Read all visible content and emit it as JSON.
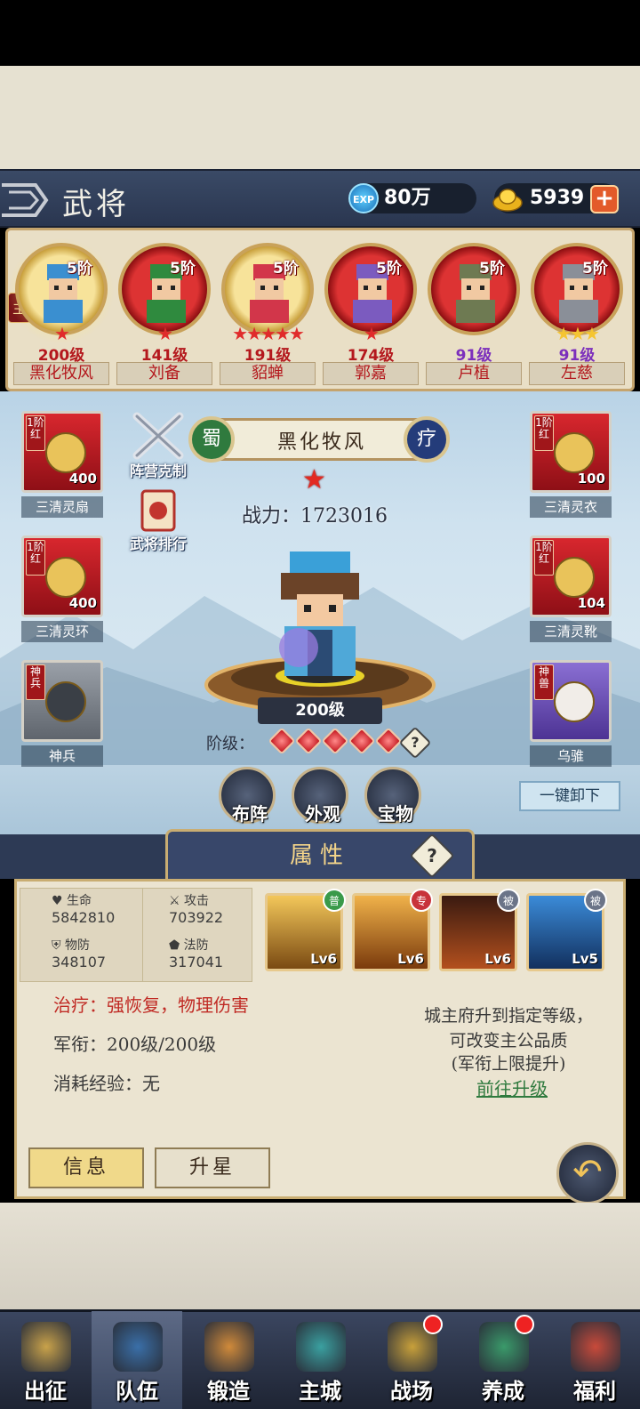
{
  "header": {
    "title": "武将",
    "exp_value": "80万",
    "exp_icon_text": "EXP",
    "gold_value": "5939"
  },
  "roster": {
    "main_tag": "主",
    "heroes": [
      {
        "name": "黑化牧风",
        "level": "200级",
        "rank": "5阶",
        "stars": "★",
        "star_color": "red",
        "frame": "gold-selected"
      },
      {
        "name": "刘备",
        "level": "141级",
        "rank": "5阶",
        "stars": "★",
        "star_color": "red",
        "frame": "red"
      },
      {
        "name": "貂蝉",
        "level": "191级",
        "rank": "5阶",
        "stars": "★★★★★",
        "star_color": "red",
        "frame": "gold"
      },
      {
        "name": "郭嘉",
        "level": "174级",
        "rank": "5阶",
        "stars": "★",
        "star_color": "red",
        "frame": "red"
      },
      {
        "name": "卢植",
        "level": "91级",
        "rank": "5阶",
        "stars": "",
        "star_color": "red",
        "frame": "red"
      },
      {
        "name": "左慈",
        "level": "91级",
        "rank": "5阶",
        "stars": "★★★",
        "star_color": "yellow",
        "frame": "red"
      }
    ]
  },
  "equipment": {
    "left": [
      {
        "name": "三清灵扇",
        "count": "400",
        "tag": "1阶红"
      },
      {
        "name": "三清灵环",
        "count": "400",
        "tag": "1阶红"
      },
      {
        "name": "神兵",
        "count": "",
        "tag": "神兵"
      }
    ],
    "right": [
      {
        "name": "三清灵衣",
        "count": "100",
        "tag": "1阶红"
      },
      {
        "name": "三清灵靴",
        "count": "104",
        "tag": "1阶红"
      },
      {
        "name": "乌骓",
        "count": "",
        "tag": "神兽"
      }
    ]
  },
  "side_buttons": {
    "camp": "阵营克制",
    "ranking": "武将排行"
  },
  "hero_detail": {
    "faction": "蜀",
    "name": "黑化牧风",
    "role": "疗",
    "star": "★",
    "power_label": "战力：",
    "power_value": "1723016",
    "level": "200级",
    "grade_label": "阶级：",
    "grade_gems": 5,
    "grade_help": "?"
  },
  "actions": {
    "formation": "布阵",
    "appearance": "外观",
    "treasure": "宝物",
    "unload_all": "一键卸下"
  },
  "attributes": {
    "tab_title": "属性",
    "help": "?",
    "stats": [
      {
        "label": "生命",
        "value": "5842810",
        "icon": "heart-icon"
      },
      {
        "label": "攻击",
        "value": "703922",
        "icon": "swords-icon"
      },
      {
        "label": "物防",
        "value": "348107",
        "icon": "armor-icon"
      },
      {
        "label": "法防",
        "value": "317041",
        "icon": "magic-shield-icon"
      }
    ],
    "skills": [
      {
        "badge": "普",
        "level": "Lv6",
        "badge_color": "#3a9a4a"
      },
      {
        "badge": "专",
        "level": "Lv6",
        "badge_color": "#c8323a"
      },
      {
        "badge": "被",
        "level": "Lv6",
        "badge_color": "#6b7488"
      },
      {
        "badge": "被",
        "level": "Lv5",
        "badge_color": "#6b7488"
      }
    ],
    "role_desc": "治疗：强恢复，物理伤害",
    "rank_text": "军衔：200级/200级",
    "exp_cost": "消耗经验：无",
    "note_line1": "城主府升到指定等级，",
    "note_line2": "可改变主公品质",
    "note_line3": "(军衔上限提升)",
    "upgrade_link": "前往升级"
  },
  "tabs": {
    "info": "信息",
    "upgrade_star": "升星"
  },
  "nav": [
    {
      "label": "出征",
      "dot": false
    },
    {
      "label": "队伍",
      "dot": false,
      "active": true
    },
    {
      "label": "锻造",
      "dot": false
    },
    {
      "label": "主城",
      "dot": false
    },
    {
      "label": "战场",
      "dot": true
    },
    {
      "label": "养成",
      "dot": true
    },
    {
      "label": "福利",
      "dot": false
    }
  ],
  "colors": {
    "accent_red": "#b4181d",
    "panel_bg": "#ebe4d1",
    "header_bg": "#2d3a55",
    "link_green": "#2f7a3e"
  }
}
